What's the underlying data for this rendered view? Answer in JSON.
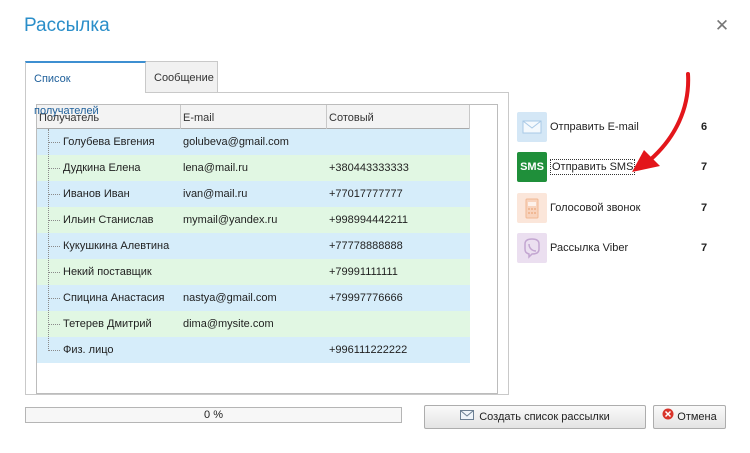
{
  "window": {
    "title": "Рассылка"
  },
  "tabs": [
    {
      "label": "Список получателей",
      "active": true
    },
    {
      "label": "Сообщение",
      "active": false
    }
  ],
  "grid": {
    "columns": [
      "Получатель",
      "E-mail",
      "Сотовый"
    ],
    "rows": [
      {
        "name": "Голубева Евгения",
        "email": "golubeva@gmail.com",
        "phone": ""
      },
      {
        "name": "Дудкина Елена",
        "email": "lena@mail.ru",
        "phone": "+380443333333"
      },
      {
        "name": "Иванов Иван",
        "email": "ivan@mail.ru",
        "phone": "+77017777777"
      },
      {
        "name": "Ильин Станислав",
        "email": "mymail@yandex.ru",
        "phone": "+998994442211"
      },
      {
        "name": "Кукушкина Алевтина",
        "email": "",
        "phone": "+77778888888"
      },
      {
        "name": "Некий поставщик",
        "email": "",
        "phone": "+79991111111"
      },
      {
        "name": "Спицина Анастасия",
        "email": "nastya@gmail.com",
        "phone": "+79997776666"
      },
      {
        "name": "Тетерев Дмитрий",
        "email": "dima@mysite.com",
        "phone": ""
      },
      {
        "name": "Физ. лицо",
        "email": "",
        "phone": "+996111222222"
      }
    ]
  },
  "actions": [
    {
      "label": "Отправить E-mail",
      "count": "6",
      "icon": "envelope-icon"
    },
    {
      "label": "Отправить SMS",
      "count": "7",
      "icon": "sms-icon",
      "icon_text": "SMS"
    },
    {
      "label": "Голосовой звонок",
      "count": "7",
      "icon": "phone-icon"
    },
    {
      "label": "Рассылка Viber",
      "count": "7",
      "icon": "viber-icon"
    }
  ],
  "footer": {
    "progress_text": "0 %",
    "progress_value": 0,
    "create_button": "Создать список рассылки",
    "cancel_button": "Отмена"
  },
  "colors": {
    "title": "#2a8ec9",
    "sms": "#1f8f3a",
    "arrow": "#e3161b",
    "row_blue": "#d6edfa",
    "row_green": "#e1f7e3"
  }
}
